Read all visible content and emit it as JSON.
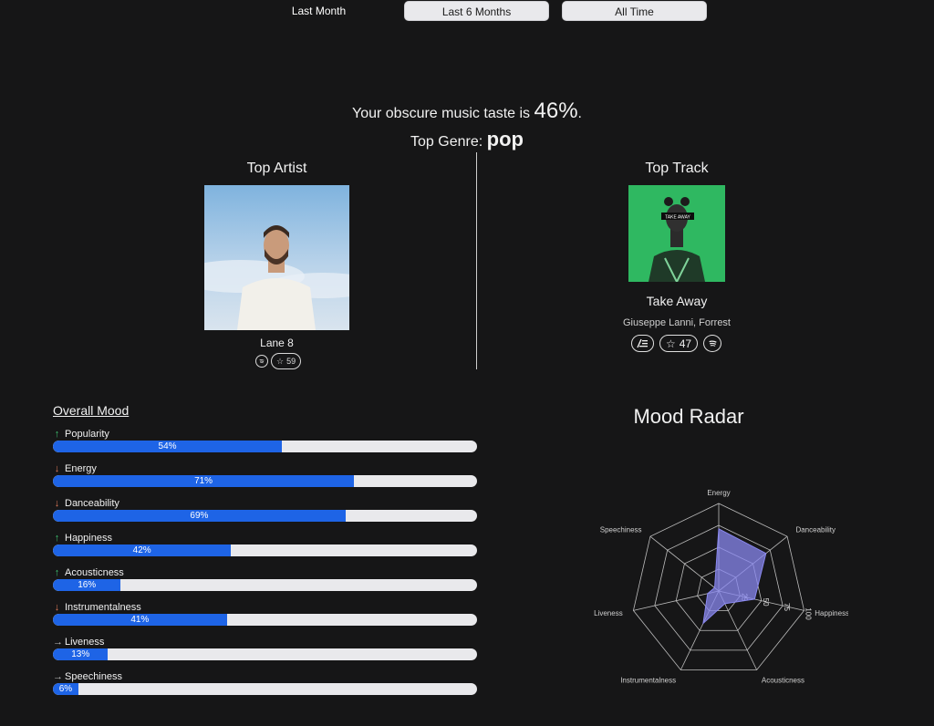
{
  "tabs": [
    {
      "label": "Last Month",
      "active": true
    },
    {
      "label": "Last 6 Months",
      "active": false
    },
    {
      "label": "All Time",
      "active": false
    }
  ],
  "obscure": {
    "prefix": "Your obscure music taste is ",
    "value": "46%",
    "suffix": "."
  },
  "genre": {
    "prefix": "Top Genre: ",
    "value": "pop"
  },
  "top_artist": {
    "title": "Top Artist",
    "name": "Lane 8",
    "popularity": "59",
    "icons": [
      "spotify-icon",
      "star-icon"
    ]
  },
  "top_track": {
    "title": "Top Track",
    "name": "Take Away",
    "artists": "Giuseppe Lanni, Forrest",
    "popularity": "47",
    "icons": [
      "lyrics-icon",
      "star-icon",
      "spotify-icon"
    ],
    "cover_text": "TAKE AWAY"
  },
  "mood": {
    "title": "Overall Mood",
    "items": [
      {
        "label": "Popularity",
        "value": "54%",
        "fraction": 0.54,
        "trend": "up"
      },
      {
        "label": "Energy",
        "value": "71%",
        "fraction": 0.71,
        "trend": "down"
      },
      {
        "label": "Danceability",
        "value": "69%",
        "fraction": 0.69,
        "trend": "down"
      },
      {
        "label": "Happiness",
        "value": "42%",
        "fraction": 0.42,
        "trend": "up"
      },
      {
        "label": "Acousticness",
        "value": "16%",
        "fraction": 0.16,
        "trend": "up"
      },
      {
        "label": "Instrumentalness",
        "value": "41%",
        "fraction": 0.41,
        "trend": "down"
      },
      {
        "label": "Liveness",
        "value": "13%",
        "fraction": 0.13,
        "trend": "flat"
      },
      {
        "label": "Speechiness",
        "value": "6%",
        "fraction": 0.06,
        "trend": "flat"
      }
    ]
  },
  "radar": {
    "title": "Mood Radar",
    "axes": [
      "Energy",
      "Danceability",
      "Happiness",
      "Acousticness",
      "Instrumentalness",
      "Liveness",
      "Speechiness"
    ],
    "values": [
      71,
      69,
      42,
      16,
      41,
      13,
      6
    ],
    "scale_ticks": [
      "25",
      "50",
      "75",
      "100"
    ],
    "max": 100,
    "fill_color": "#8a88f0"
  },
  "colors": {
    "bar": "#1e64e6",
    "bar_bg": "#e9e9ec",
    "background": "#161617",
    "up": "#3dbf6e",
    "down": "#e07a5a"
  }
}
